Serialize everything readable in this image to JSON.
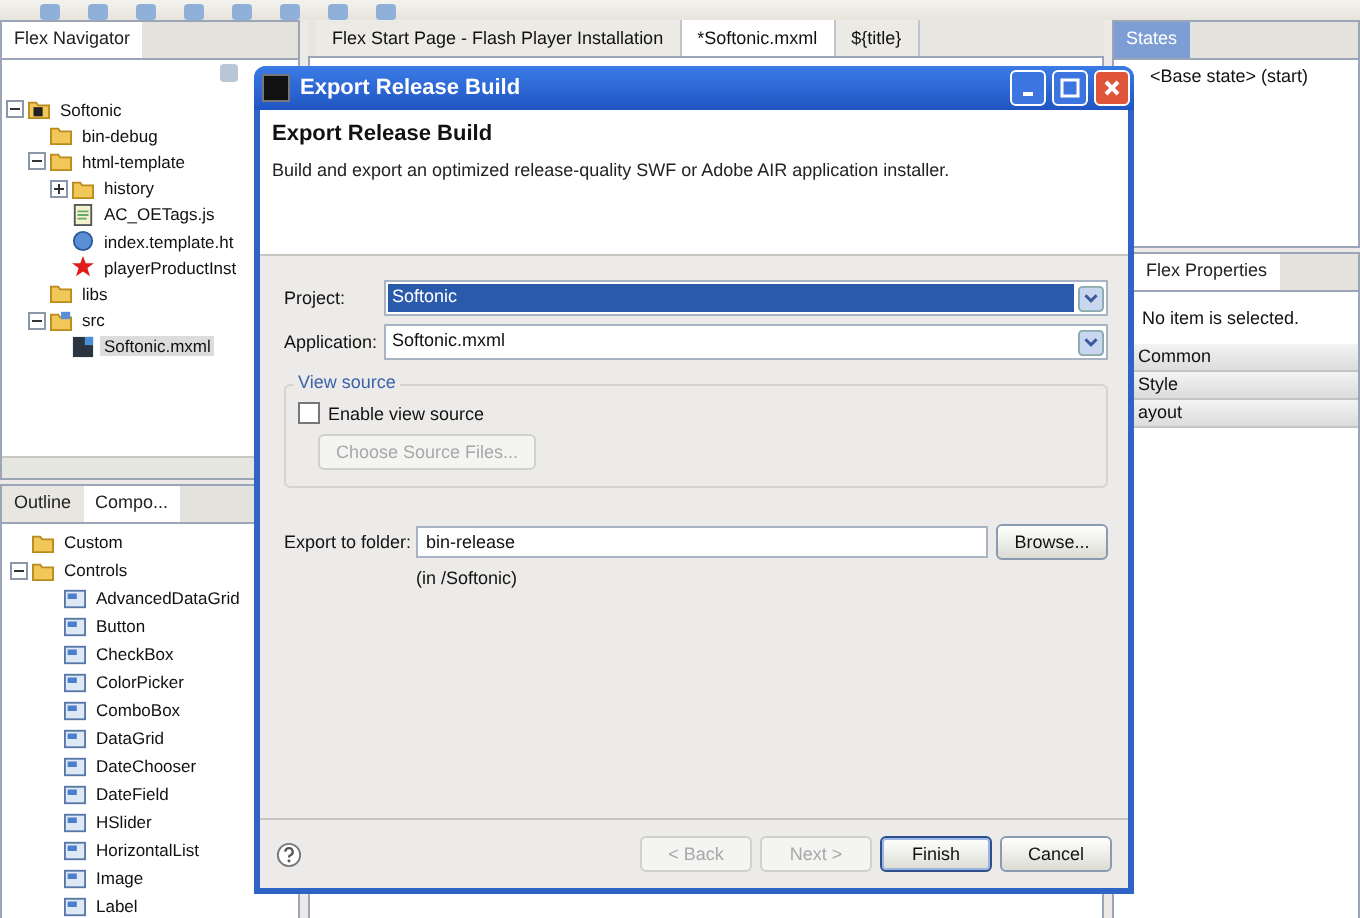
{
  "navigator": {
    "tabs": [
      {
        "label": "Flex Navigator",
        "selected": true
      }
    ],
    "tree": [
      {
        "label": "Softonic",
        "kind": "project",
        "expanded": true,
        "selected": false,
        "children": [
          {
            "label": "bin-debug",
            "kind": "folder",
            "selected": false
          },
          {
            "label": "html-template",
            "kind": "folder",
            "expanded": true,
            "selected": false,
            "children": [
              {
                "label": "history",
                "kind": "folder",
                "expanded": false,
                "selected": false
              },
              {
                "label": "AC_OETags.js",
                "kind": "script",
                "selected": false
              },
              {
                "label": "index.template.ht",
                "kind": "web-page",
                "selected": false
              },
              {
                "label": "playerProductInst",
                "kind": "player",
                "selected": false
              }
            ]
          },
          {
            "label": "libs",
            "kind": "folder",
            "selected": false
          },
          {
            "label": "src",
            "kind": "source-folder",
            "expanded": true,
            "selected": false,
            "children": [
              {
                "label": "Softonic.mxml",
                "kind": "mxml",
                "selected": true
              }
            ]
          }
        ]
      }
    ]
  },
  "components": {
    "tabs": [
      {
        "label": "Outline",
        "selected": false
      },
      {
        "label": "Compo...",
        "selected": true
      }
    ],
    "tree": [
      {
        "label": "Custom",
        "kind": "folder"
      },
      {
        "label": "Controls",
        "kind": "folder",
        "expanded": true,
        "children": [
          {
            "label": "AdvancedDataGrid",
            "kind": "component"
          },
          {
            "label": "Button",
            "kind": "component"
          },
          {
            "label": "CheckBox",
            "kind": "component"
          },
          {
            "label": "ColorPicker",
            "kind": "component"
          },
          {
            "label": "ComboBox",
            "kind": "component"
          },
          {
            "label": "DataGrid",
            "kind": "component"
          },
          {
            "label": "DateChooser",
            "kind": "component"
          },
          {
            "label": "DateField",
            "kind": "component"
          },
          {
            "label": "HSlider",
            "kind": "component"
          },
          {
            "label": "HorizontalList",
            "kind": "component"
          },
          {
            "label": "Image",
            "kind": "component"
          },
          {
            "label": "Label",
            "kind": "component"
          }
        ]
      }
    ]
  },
  "editor": {
    "tabs": [
      {
        "label": "Flex Start Page - Flash Player Installation",
        "selected": false
      },
      {
        "label": "*Softonic.mxml",
        "selected": true
      },
      {
        "label": "${title}",
        "selected": false
      }
    ]
  },
  "states": {
    "active": true,
    "tabs": [
      {
        "label": "States",
        "selected": true
      }
    ],
    "items": [
      "<Base state> (start)"
    ]
  },
  "properties": {
    "tabs": [
      {
        "label": "Flex Properties",
        "selected": true
      }
    ],
    "message": "No item is selected.",
    "sections": [
      "Common",
      "Style",
      "ayout"
    ]
  },
  "dialog": {
    "title": "Export Release Build",
    "heading": "Export Release Build",
    "description": "Build and export an optimized release-quality SWF or Adobe AIR application installer.",
    "project": {
      "label": "Project:",
      "value": "Softonic",
      "focused": true
    },
    "application": {
      "label": "Application:",
      "value": "Softonic.mxml",
      "focused": false
    },
    "view_source": {
      "legend": "View source",
      "checkbox": "Enable view source",
      "checked": false,
      "button": "Choose Source Files...",
      "button_disabled": true
    },
    "export": {
      "label": "Export to folder:",
      "value": "bin-release",
      "browse": "Browse...",
      "note": "(in /Softonic)"
    },
    "buttons": [
      {
        "label": "< Back",
        "disabled": true,
        "default": false
      },
      {
        "label": "Next >",
        "disabled": true,
        "default": false
      },
      {
        "label": "Finish",
        "disabled": false,
        "default": true
      },
      {
        "label": "Cancel",
        "disabled": false,
        "default": false
      }
    ]
  }
}
